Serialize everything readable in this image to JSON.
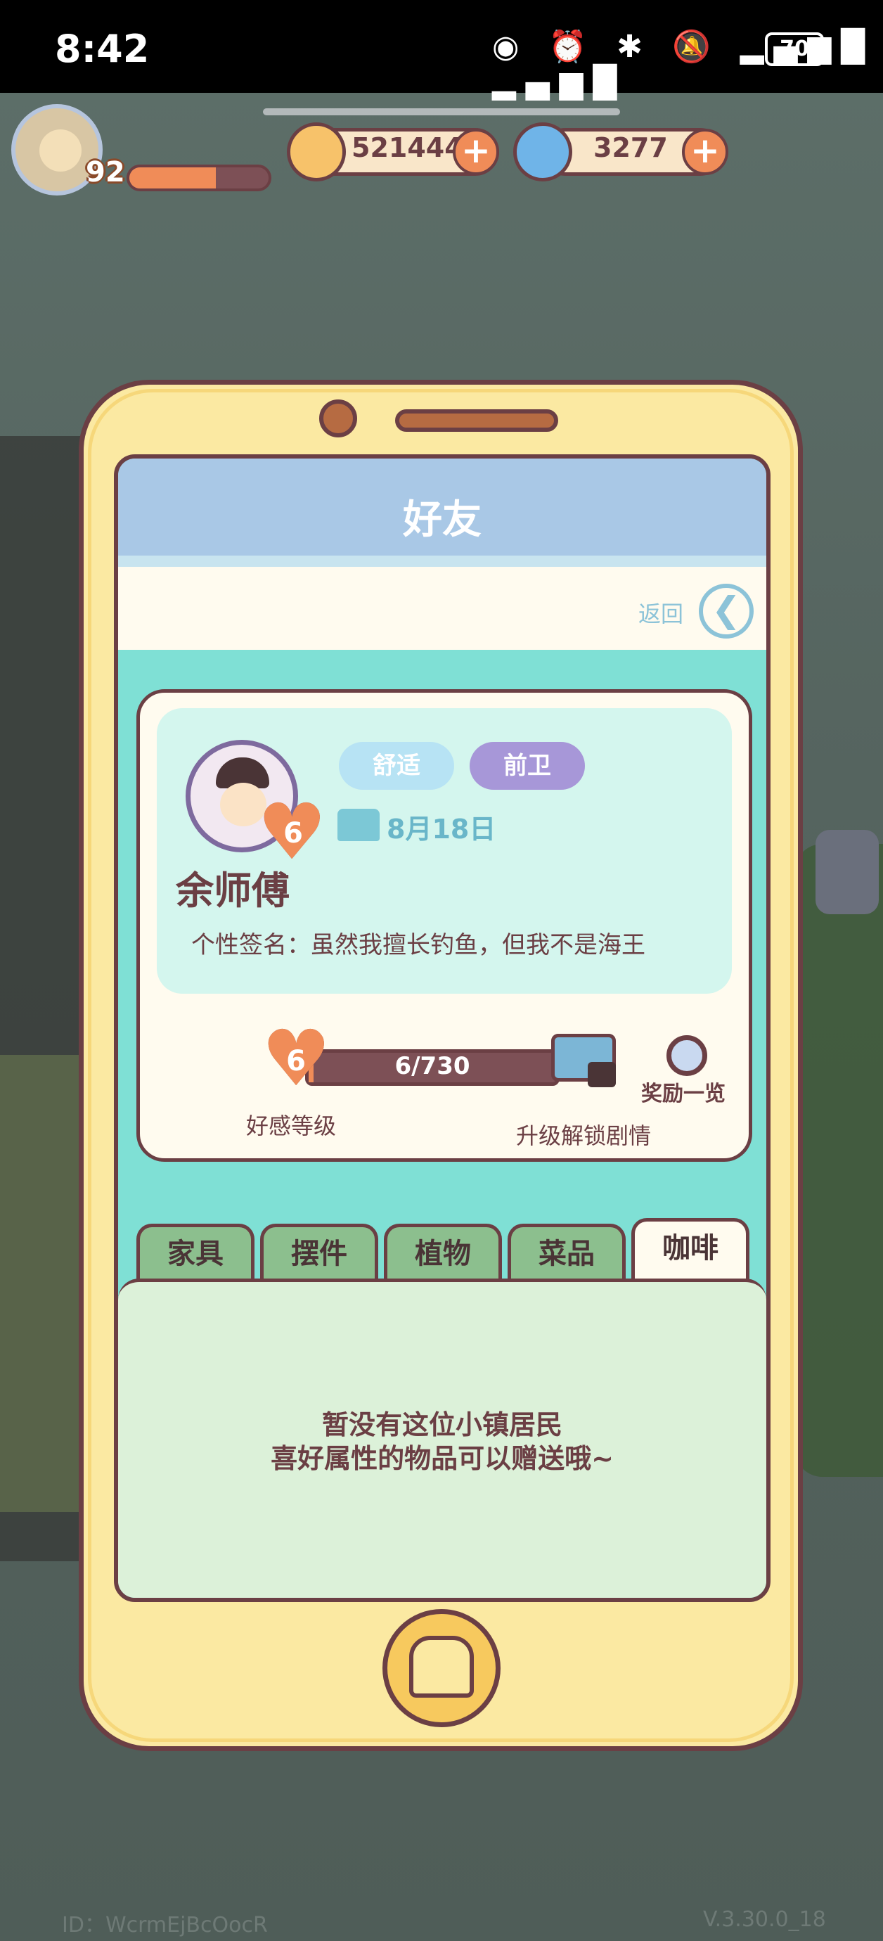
{
  "status_bar": {
    "time": "8:42",
    "icons": "◉ ⏰ ✱ 🔕 ▂▄▆█ ▂▄▆█",
    "battery": "70"
  },
  "hud": {
    "player_level": "92",
    "xp_progress": 0.62,
    "coins": "521444",
    "gems": "3277",
    "plus_glyph": "+"
  },
  "friend_screen": {
    "title": "好友",
    "back_label": "返回",
    "back_glyph": "❮",
    "npc": {
      "name": "余师傅",
      "tags": [
        "舒适",
        "前卫"
      ],
      "birthday": "8月18日",
      "signature": "个性签名：虽然我擅长钓鱼，但我不是海王",
      "heart_level": "6"
    },
    "affection": {
      "level": "6",
      "progress_text": "6/730",
      "progress": 0.008,
      "level_label": "好感等级",
      "unlock_label": "升级解锁剧情",
      "reward_label": "奖励一览"
    },
    "tabs": [
      "家具",
      "摆件",
      "植物",
      "菜品",
      "咖啡"
    ],
    "active_tab": "咖啡",
    "empty_line1": "暂没有这位小镇居民",
    "empty_line2": "喜好属性的物品可以赠送哦~"
  },
  "footer": {
    "id_text": "ID：WcrmEjBcOocR",
    "version": "V.3.30.0_18"
  },
  "colors": {
    "accent": "#f08c58",
    "outline": "#6b3f44",
    "tag_comfort": "#b7e3f4",
    "tag_avant": "#a797d8"
  },
  "icons": [
    "heart-icon",
    "cake-icon",
    "lock-icon",
    "magnifier-icon",
    "bread-icon",
    "coin-icon",
    "gem-icon"
  ]
}
